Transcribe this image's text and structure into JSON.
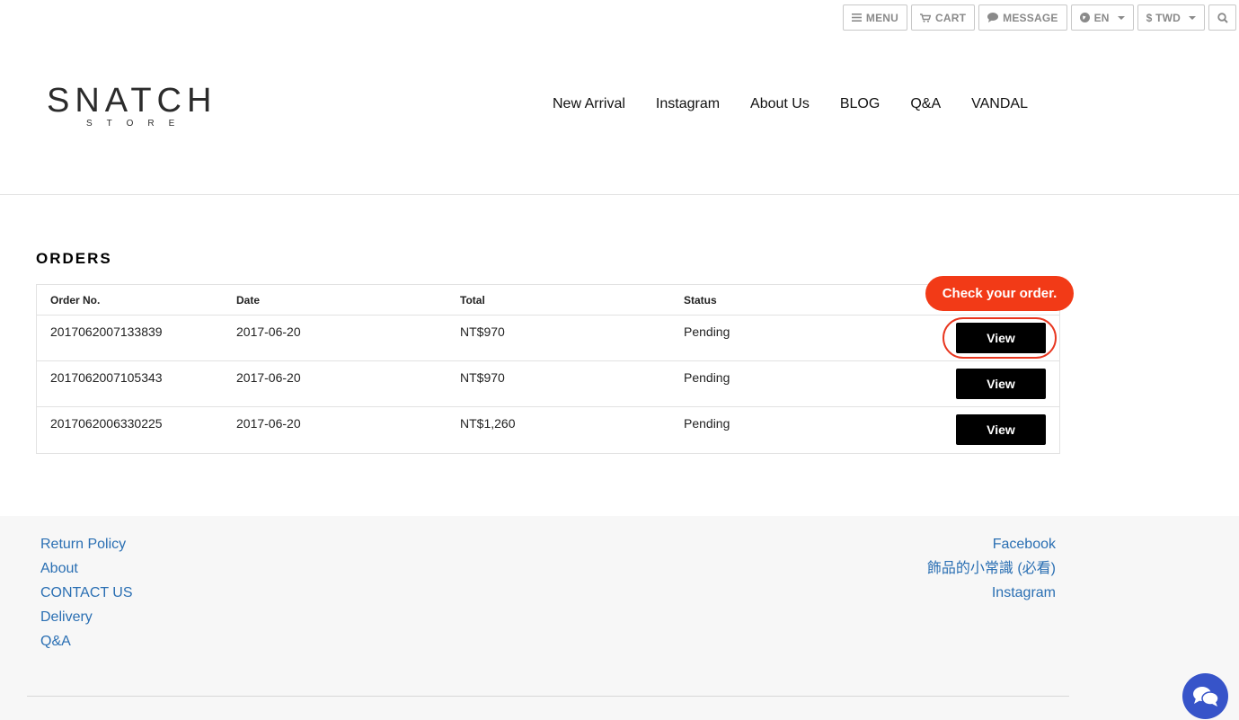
{
  "topbar": {
    "menu": "MENU",
    "cart": "CART",
    "message": "MESSAGE",
    "language": "EN",
    "currency": "$ TWD"
  },
  "logo": {
    "main": "SNATCH",
    "sub": "STORE"
  },
  "nav": [
    "New Arrival",
    "Instagram",
    "About Us",
    "BLOG",
    "Q&A",
    "VANDAL"
  ],
  "orders": {
    "title": "ORDERS",
    "columns": [
      "Order No.",
      "Date",
      "Total",
      "Status"
    ],
    "rows": [
      {
        "order_no": "2017062007133839",
        "date": "2017-06-20",
        "total": "NT$970",
        "status": "Pending",
        "action": "View"
      },
      {
        "order_no": "2017062007105343",
        "date": "2017-06-20",
        "total": "NT$970",
        "status": "Pending",
        "action": "View"
      },
      {
        "order_no": "2017062006330225",
        "date": "2017-06-20",
        "total": "NT$1,260",
        "status": "Pending",
        "action": "View"
      }
    ],
    "callout": "Check your order."
  },
  "footer": {
    "left_links": [
      "Return Policy",
      "About",
      "CONTACT US",
      "Delivery",
      "Q&A"
    ],
    "right_links": [
      "Facebook",
      "飾品的小常識 (必看)",
      "Instagram"
    ]
  },
  "colors": {
    "accent": "#f23a17",
    "link": "#2a6fb3",
    "chat": "#3754c9"
  }
}
